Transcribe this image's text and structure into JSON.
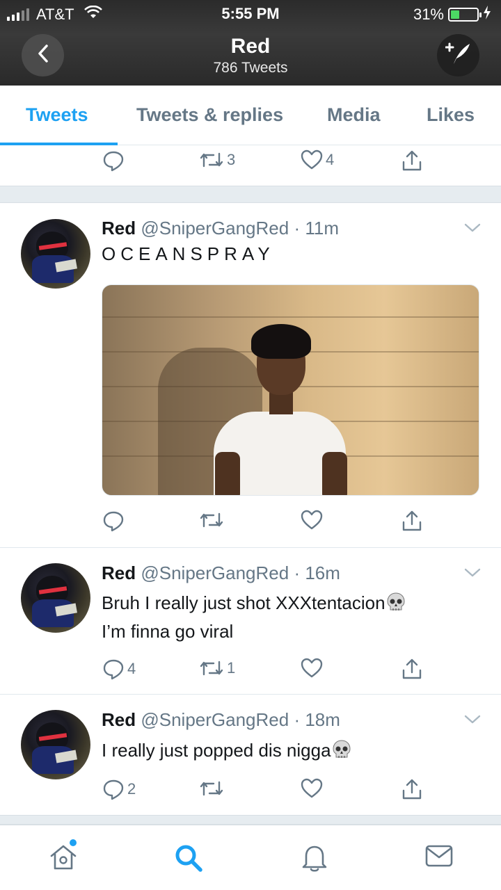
{
  "status_bar": {
    "carrier": "AT&T",
    "time": "5:55 PM",
    "battery": "31%",
    "battery_level": 0.31
  },
  "header": {
    "title": "Red",
    "subtitle": "786 Tweets"
  },
  "tabs": [
    {
      "label": "Tweets",
      "active": true
    },
    {
      "label": "Tweets & replies",
      "active": false
    },
    {
      "label": "Media",
      "active": false
    },
    {
      "label": "Likes",
      "active": false
    }
  ],
  "top_actions": {
    "reply_count": "",
    "retweet_count": "3",
    "like_count": "4"
  },
  "tweets": [
    {
      "name": "Red",
      "handle": "@SniperGangRed",
      "time": "· 11m",
      "text": "OCEANSPRAY",
      "has_photo": true,
      "reply_count": "",
      "retweet_count": "",
      "like_count": ""
    },
    {
      "name": "Red",
      "handle": "@SniperGangRed",
      "time": "· 16m",
      "text_line1": "Bruh I really just shot XXXtentacion",
      "text_line2": "I’m finna go viral",
      "reply_count": "4",
      "retweet_count": "1",
      "like_count": ""
    },
    {
      "name": "Red",
      "handle": "@SniperGangRed",
      "time": "· 18m",
      "text": "I really just popped dis nigga",
      "reply_count": "2",
      "retweet_count": "",
      "like_count": ""
    }
  ],
  "icons": {
    "back": "chevron-left-icon",
    "compose": "compose-tweet-icon",
    "reply": "reply-bubble-icon",
    "retweet": "retweet-icon",
    "like": "heart-icon",
    "share": "share-icon",
    "emoji": "skull-emoji",
    "nav": [
      "home-icon",
      "search-icon",
      "notifications-bell-icon",
      "messages-envelope-icon"
    ]
  },
  "colors": {
    "accent": "#1da1f2",
    "muted": "#657786",
    "battery_green": "#4cd964"
  }
}
